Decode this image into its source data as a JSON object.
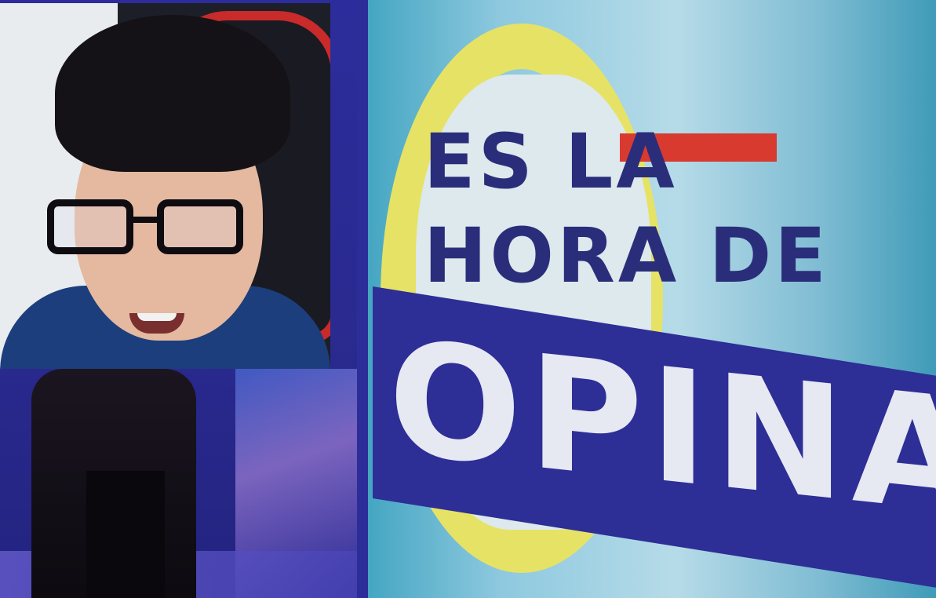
{
  "screen_graphic": {
    "line1": "ES LA",
    "line2": "HORA DE",
    "headline": "OPINAR"
  },
  "colors": {
    "band_navy": "#2d2e96",
    "ring_yellow": "#e6e266",
    "accent_red": "#d83a30",
    "text_navy": "#2a2e7a",
    "headline_white": "#e6e8f2",
    "studio_blue": "#2c2c9c"
  }
}
